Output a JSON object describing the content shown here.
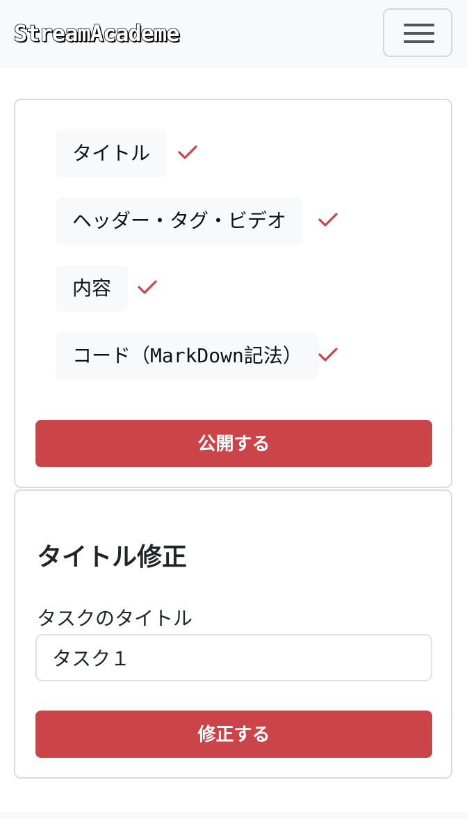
{
  "navbar": {
    "brand": "StreamAcademe",
    "toggler_icon": "hamburger-menu-icon"
  },
  "steps_card": {
    "steps": [
      {
        "label": "タイトル",
        "done": true
      },
      {
        "label": "ヘッダー・タグ・ビデオ",
        "done": true
      },
      {
        "label": "内容",
        "done": true
      },
      {
        "label": "コード（MarkDown記法）",
        "done": true
      }
    ],
    "check_icon": "checkmark-icon",
    "publish_label": "公開する"
  },
  "edit_card": {
    "title": "タイトル修正",
    "field_label": "タスクのタイトル",
    "field_value": "タスク１",
    "submit_label": "修正する"
  },
  "colors": {
    "accent": "#cb444a",
    "check": "#cb444a",
    "navbar_bg": "#f8f9fa",
    "step_bg": "#f8f9fa"
  }
}
